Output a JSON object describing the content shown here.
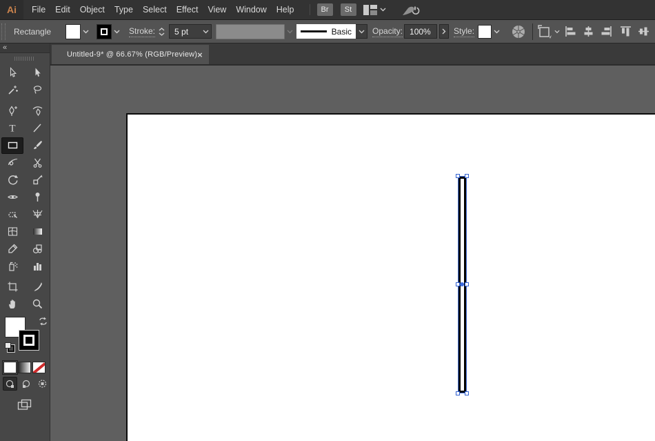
{
  "menu_bar": {
    "logo": "Ai",
    "items": [
      "File",
      "Edit",
      "Object",
      "Type",
      "Select",
      "Effect",
      "View",
      "Window",
      "Help"
    ],
    "bridge_button": "Br",
    "stock_button": "St"
  },
  "control_bar": {
    "context_label": "Rectangle",
    "stroke_label": "Stroke:",
    "stroke_weight": "5 pt",
    "brush_name": "Basic",
    "opacity_label": "Opacity:",
    "opacity_value": "100%",
    "style_label": "Style:"
  },
  "tab_bar": {
    "tab_title": "Untitled-9* @ 66.67% (RGB/Preview)",
    "close": "×"
  },
  "tool_panel": {
    "collapse_glyph": "«",
    "selected_tool": "rectangle-tool",
    "tools": [
      "selection-tool",
      "direct-selection-tool",
      "magic-wand-tool",
      "lasso-tool",
      "pen-tool",
      "curvature-tool",
      "type-tool",
      "line-segment-tool",
      "rectangle-tool",
      "paintbrush-tool",
      "shaper-tool",
      "scissors-tool",
      "rotate-tool",
      "scale-tool",
      "width-tool",
      "puppet-warp-tool",
      "shape-builder-tool",
      "perspective-grid-tool",
      "mesh-tool",
      "gradient-tool",
      "eyedropper-tool",
      "blend-tool",
      "symbol-sprayer-tool",
      "column-graph-tool",
      "artboard-tool",
      "slice-tool",
      "hand-tool",
      "zoom-tool"
    ]
  },
  "canvas": {
    "selection": {
      "shape": "rectangle",
      "fill": "white",
      "stroke_color": "black",
      "selected": true
    }
  },
  "colors": {
    "accent_blue": "#4470dd",
    "logo_orange": "#c9824c",
    "pasteboard": "#5f5f5f"
  }
}
